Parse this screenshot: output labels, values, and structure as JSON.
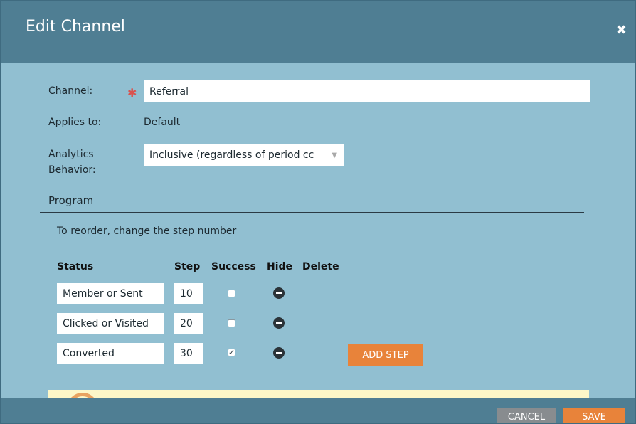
{
  "dialog": {
    "title": "Edit Channel",
    "close_glyph": "✖"
  },
  "form": {
    "channel_label": "Channel:",
    "required_glyph": "✱",
    "channel_value": "Referral",
    "applies_to_label": "Applies to:",
    "applies_to_value": "Default",
    "analytics_label_line1": "Analytics",
    "analytics_label_line2": "Behavior:",
    "analytics_value": "Inclusive (regardless of period cc",
    "analytics_arrow": "▼"
  },
  "program": {
    "title": "Program",
    "hint": "To reorder, change the step number",
    "headers": {
      "status": "Status",
      "step": "Step",
      "success": "Success",
      "hide": "Hide",
      "delete": "Delete"
    },
    "rows": [
      {
        "status": "Member or Sent",
        "step": "10",
        "success": false
      },
      {
        "status": "Clicked or Visited",
        "step": "20",
        "success": false
      },
      {
        "status": "Converted",
        "step": "30",
        "success": true
      }
    ],
    "add_step_label": "ADD STEP",
    "check_glyph": "✓"
  },
  "footer": {
    "cancel_label": "CANCEL",
    "save_label": "SAVE"
  },
  "colors": {
    "titlebar": "#4f7e93",
    "body": "#91bfd1",
    "accent": "#e8833a"
  },
  "icons": [
    "close-icon",
    "required-asterisk-icon",
    "dropdown-arrow-icon",
    "hide-minus-icon",
    "checkbox-icon",
    "warning-icon"
  ]
}
